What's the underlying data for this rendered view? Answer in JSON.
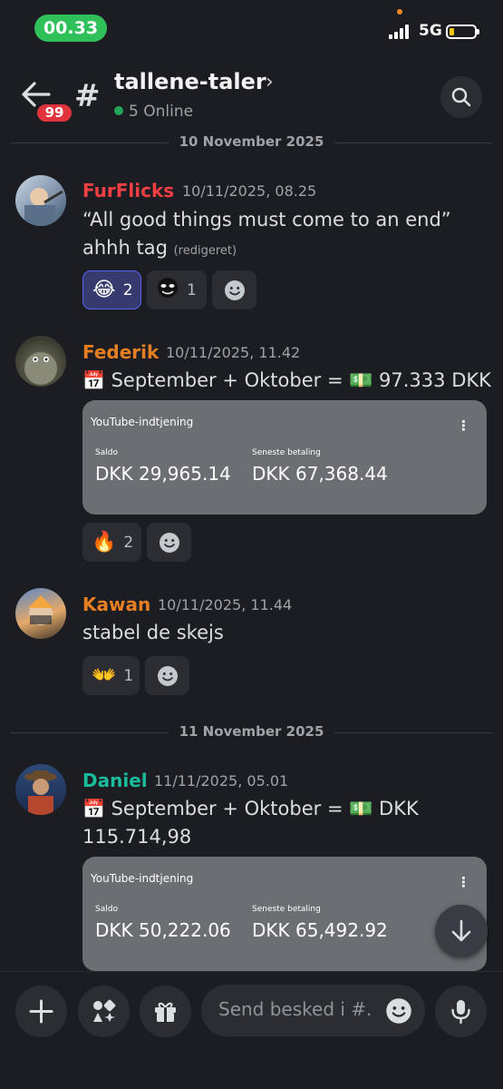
{
  "status": {
    "time": "00.33",
    "network": "5G"
  },
  "header": {
    "back_badge": "99",
    "channel_name": "tallene-taler",
    "online": "5 Online"
  },
  "dividers": [
    "10 November 2025",
    "11 November 2025"
  ],
  "messages": [
    {
      "author": "FurFlicks",
      "author_color": "#f23f43",
      "timestamp": "10/11/2025, 08.25",
      "line1": "“All good things must come to an end”",
      "line2": "ahhh tag",
      "edited": "(redigeret)",
      "reactions": [
        {
          "emoji": "😂",
          "count": "2"
        },
        {
          "emoji": "custom-emote",
          "count": "1"
        }
      ]
    },
    {
      "author": "Federik",
      "author_color": "#e67e22",
      "timestamp": "10/11/2025, 11.42",
      "text": "September + Oktober = 💵 97.333 DKK",
      "calendar_emoji": "📅",
      "embed": {
        "title": "YouTube-indtjening",
        "balance_label": "Saldo",
        "balance_value": "DKK 29,965.14",
        "last_payment_label": "Seneste betaling",
        "last_payment_value": "DKK 67,368.44"
      },
      "reactions": [
        {
          "emoji": "🔥",
          "count": "2"
        }
      ]
    },
    {
      "author": "Kawan",
      "author_color": "#e67e22",
      "timestamp": "10/11/2025, 11.44",
      "text": "stabel de skejs",
      "reactions": [
        {
          "emoji": "👐",
          "count": "1"
        }
      ]
    },
    {
      "author": "Daniel",
      "author_color": "#1abc9c",
      "timestamp": "11/11/2025, 05.01",
      "line1": "September + Oktober = 💵 DKK",
      "line2": "115.714,98",
      "calendar_emoji": "📅",
      "embed": {
        "title": "YouTube-indtjening",
        "balance_label": "Saldo",
        "balance_value": "DKK 50,222.06",
        "last_payment_label": "Seneste betaling",
        "last_payment_value": "DKK 65,492.92"
      }
    }
  ],
  "composer": {
    "placeholder": "Send besked i #.."
  }
}
